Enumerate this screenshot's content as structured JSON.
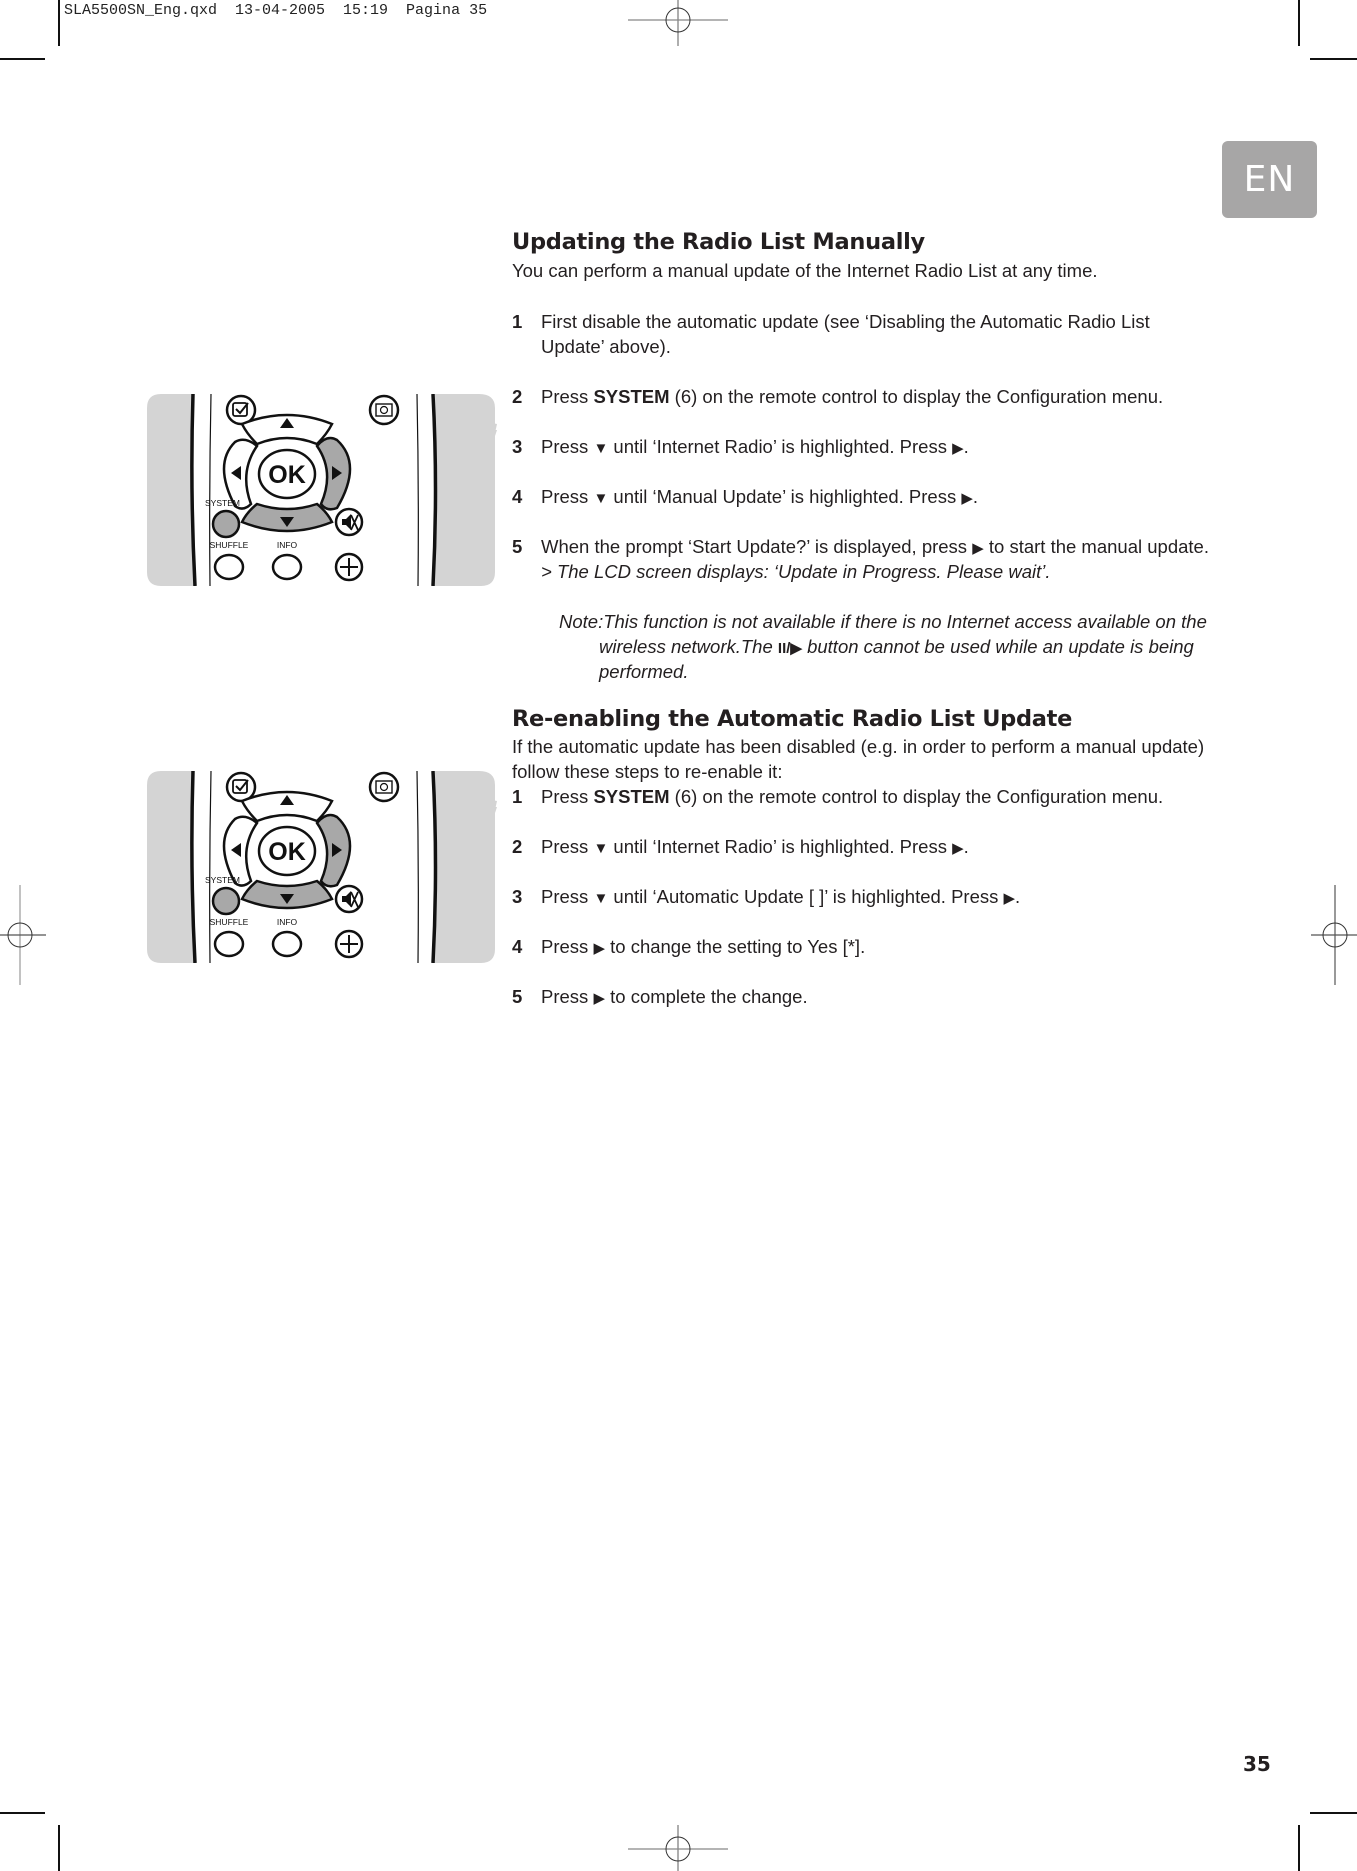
{
  "slug": "SLA5500SN_Eng.qxd  13-04-2005  15:19  Pagina 35",
  "language_tab": "EN",
  "page_number": "35",
  "section1": {
    "heading": "Updating the Radio List Manually",
    "intro": "You can perform a manual update of the Internet Radio List at any time.",
    "steps": [
      {
        "num": "1",
        "lines": [
          "First disable the automatic update (see ‘Disabling the Automatic Radio List",
          "Update’ above)."
        ]
      },
      {
        "num": "2",
        "pre": "Press ",
        "bold": "SYSTEM",
        "post": " (6) on the remote control to display the Configuration menu."
      },
      {
        "num": "3",
        "a": "Press ",
        "sym1": "▼",
        "b": " until ‘Internet Radio’ is highlighted. Press ",
        "sym2": "▶",
        "c": "."
      },
      {
        "num": "4",
        "a": "Press ",
        "sym1": "▼",
        "b": " until ‘Manual Update’ is highlighted. Press ",
        "sym2": "▶",
        "c": "."
      },
      {
        "num": "5",
        "a": "When the prompt ‘Start Update?’ is displayed, press ",
        "sym1": "▶",
        "b": " to start the manual update.",
        "result": "> The LCD screen displays: ‘Update in Progress. Please wait’."
      }
    ],
    "note": {
      "line1": "Note:This function is not available if there is no Internet access available on the",
      "line2a": "wireless network.The ",
      "line2sym": "II/▶",
      "line2b": " button cannot be used while an update is being",
      "line3": "performed."
    }
  },
  "section2": {
    "heading": "Re-enabling the Automatic Radio List Update",
    "intro1": "If the automatic update has been disabled (e.g. in order to perform a manual update)",
    "intro2": "follow these steps to re-enable it:",
    "steps": [
      {
        "num": "1",
        "pre": "Press ",
        "bold": "SYSTEM",
        "post": " (6) on the remote control to display the Configuration menu."
      },
      {
        "num": "2",
        "a": "Press ",
        "sym1": "▼",
        "b": " until ‘Internet Radio’ is highlighted. Press ",
        "sym2": "▶",
        "c": "."
      },
      {
        "num": "3",
        "a": "Press ",
        "sym1": "▼",
        "b": " until ‘Automatic Update [ ]’ is highlighted. Press ",
        "sym2": "▶",
        "c": "."
      },
      {
        "num": "4",
        "a": "Press ",
        "sym1": "▶",
        "b": " to change the setting to Yes [*]."
      },
      {
        "num": "5",
        "a": "Press ",
        "sym1": "▶",
        "b": " to complete the change."
      }
    ]
  },
  "remote": {
    "ok_label": "OK",
    "system_label": "SYSTEM",
    "shuffle_label": "SHUFFLE",
    "info_label": "INFO",
    "highlighted_buttons": [
      "right",
      "down",
      "system"
    ]
  },
  "colors": {
    "lang_tab_bg": "#a7a6a6",
    "remote_panel": "#d4d4d4",
    "highlight_button": "#a8a8a8",
    "text": "#231f20"
  }
}
